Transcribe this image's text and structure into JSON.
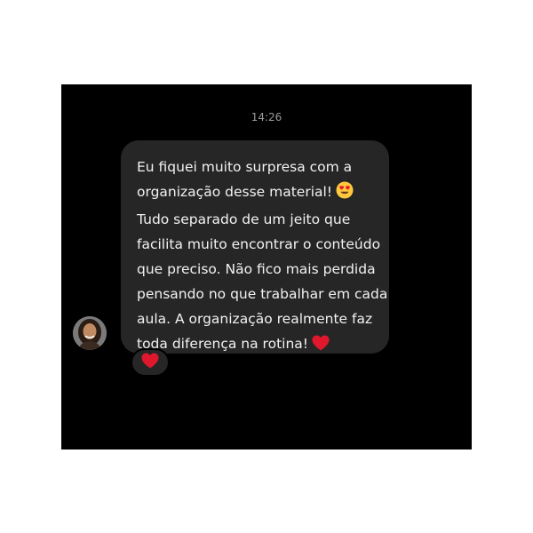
{
  "chat": {
    "timestamp": "14:26",
    "message": {
      "lines": [
        "Eu fiquei muito surpresa com a",
        "organização desse material!",
        "Tudo separado de um jeito que",
        "facilita muito encontrar o conteúdo",
        "que preciso. Não fico mais perdida",
        "pensando no que trabalhar em cada",
        "aula. A organização realmente faz",
        "toda diferença na rotina!"
      ],
      "emojis": [
        "heart-eyes-emoji",
        "red-heart-emoji"
      ]
    },
    "reaction": {
      "icon": "red-heart-icon"
    },
    "colors": {
      "background": "#000000",
      "bubble": "#262626",
      "text": "#f2f2f2",
      "timestamp": "#9a9a9a",
      "heart": "#e0182d"
    }
  }
}
